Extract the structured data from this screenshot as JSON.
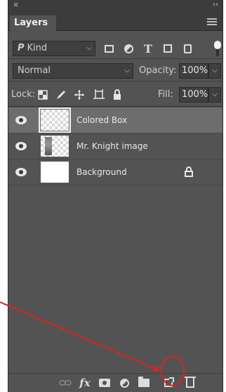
{
  "titlebar": {
    "close": "×",
    "collapse": "‹‹"
  },
  "tab": {
    "label": "Layers"
  },
  "filter": {
    "kind_label": "Kind",
    "search_glyph": "P",
    "icons": [
      "pixel-filter-icon",
      "adjustment-filter-icon",
      "type-filter-icon",
      "shape-filter-icon",
      "smart-object-filter-icon"
    ],
    "type_glyph": "T"
  },
  "blend": {
    "mode": "Normal",
    "opacity_label": "Opacity:",
    "opacity_value": "100%"
  },
  "lock": {
    "label": "Lock:",
    "fill_label": "Fill:",
    "fill_value": "100%"
  },
  "layers": [
    {
      "name": "Colored Box",
      "selected": true,
      "thumb": "transparent"
    },
    {
      "name": "Mr. Knight image",
      "selected": false,
      "thumb": "image"
    },
    {
      "name": "Background",
      "selected": false,
      "thumb": "white",
      "locked": true
    }
  ],
  "bottom_bar": {
    "fx_label": "fx",
    "icons": [
      "link-layers-icon",
      "layer-style-icon",
      "add-mask-icon",
      "adjustment-layer-icon",
      "new-group-icon",
      "new-layer-icon",
      "delete-layer-icon"
    ]
  },
  "colors": {
    "panel_bg": "#535353",
    "selected_row": "#6d6d6d",
    "annotation": "#e02020"
  }
}
